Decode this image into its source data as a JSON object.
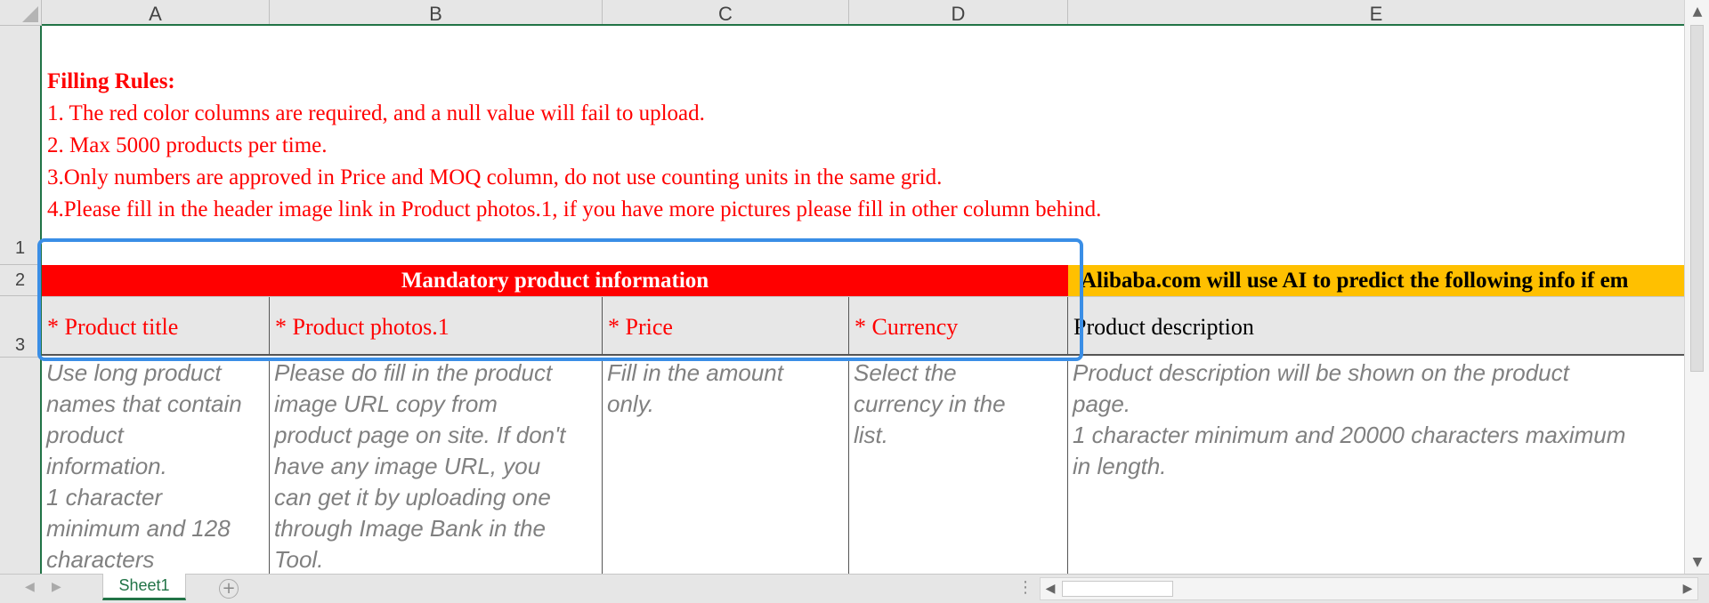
{
  "columns": [
    "A",
    "B",
    "C",
    "D",
    "E"
  ],
  "rows": [
    "1",
    "2",
    "3"
  ],
  "rules": {
    "title": "Filling Rules:",
    "lines": [
      "1. The red color columns are required, and a null value will fail to upload.",
      "2. Max 5000 products per time.",
      "3.Only numbers are approved in Price and MOQ column, do not use counting units in the same grid.",
      "4.Please fill in the header image link in Product photos.1, if you have more pictures please fill in other column behind."
    ]
  },
  "bands": {
    "mandatory": "Mandatory product information",
    "ai_predict": "Alibaba.com will use AI to predict the following info if em"
  },
  "headers": [
    "* Product title",
    "* Product photos.1",
    "* Price",
    "* Currency",
    "Product description"
  ],
  "descriptions": [
    [
      "Use long product",
      "names that contain",
      "product",
      "information.",
      "1 character",
      "minimum and 128",
      "characters"
    ],
    [
      "Please do fill in the product",
      "image URL copy from",
      "product page on site. If don't",
      "have any image URL,  you",
      "can get it by uploading one",
      "through Image Bank in the",
      "Tool."
    ],
    [
      "Fill in the amount",
      "only."
    ],
    [
      "Select the",
      "currency in the",
      "list."
    ],
    [
      "Product description will be shown on the product",
      "page.",
      "1 character minimum and 20000 characters maximum",
      "in length."
    ]
  ],
  "sheet_tab": "Sheet1",
  "colors": {
    "required_red": "#ff0000",
    "ai_band_yellow": "#ffc000",
    "selection_blue": "#3a8ee6",
    "excel_green": "#217346"
  },
  "icons": {
    "add_sheet": "plus-circle-icon",
    "scroll_up": "triangle-up-icon",
    "scroll_down": "triangle-down-icon",
    "scroll_left": "triangle-left-icon",
    "scroll_right": "triangle-right-icon"
  }
}
